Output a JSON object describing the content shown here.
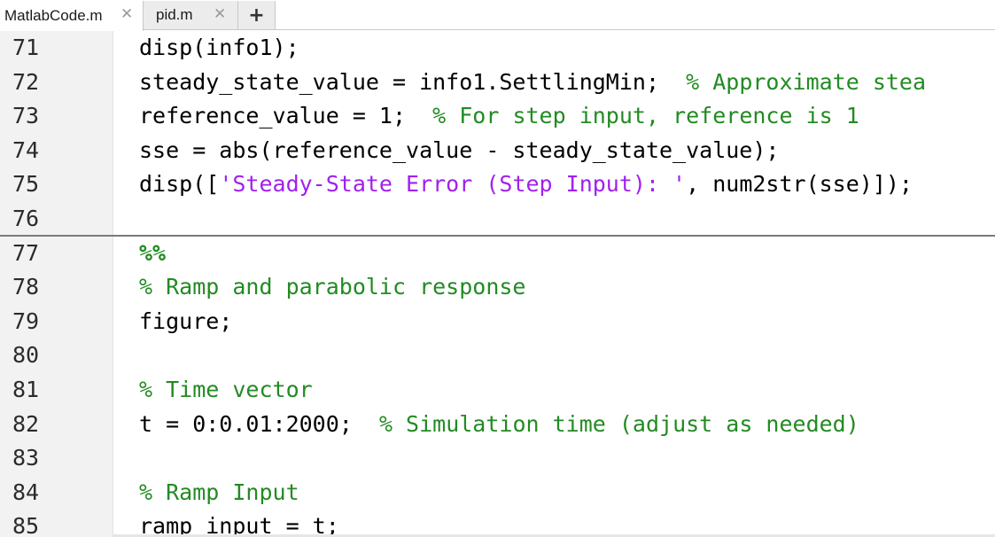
{
  "tabs": [
    {
      "label": "MatlabCode.m",
      "active": true,
      "close_icon": "close-icon"
    },
    {
      "label": "pid.m",
      "active": false,
      "close_icon": "close-icon"
    }
  ],
  "add_tab": {
    "label": "+"
  },
  "colors": {
    "comment": "#228b22",
    "string": "#a020f0",
    "plain": "#000000",
    "gutter": "#f2f2f2"
  },
  "editor": {
    "lines": [
      {
        "num": "71",
        "tokens": [
          {
            "t": "plain",
            "v": "disp(info1);"
          }
        ]
      },
      {
        "num": "72",
        "tokens": [
          {
            "t": "plain",
            "v": "steady_state_value = info1.SettlingMin;  "
          },
          {
            "t": "comment",
            "v": "% Approximate stea"
          }
        ]
      },
      {
        "num": "73",
        "tokens": [
          {
            "t": "plain",
            "v": "reference_value = 1;  "
          },
          {
            "t": "comment",
            "v": "% For step input, reference is 1"
          }
        ]
      },
      {
        "num": "74",
        "tokens": [
          {
            "t": "plain",
            "v": "sse = abs(reference_value - steady_state_value);"
          }
        ]
      },
      {
        "num": "75",
        "tokens": [
          {
            "t": "plain",
            "v": "disp(["
          },
          {
            "t": "string",
            "v": "'Steady-State Error (Step Input): '"
          },
          {
            "t": "plain",
            "v": ", num2str(sse)]);"
          }
        ]
      },
      {
        "num": "76",
        "tokens": []
      },
      {
        "num": "77",
        "tokens": [
          {
            "t": "section",
            "v": "%%"
          }
        ]
      },
      {
        "num": "78",
        "tokens": [
          {
            "t": "comment",
            "v": "% Ramp and parabolic response"
          }
        ]
      },
      {
        "num": "79",
        "tokens": [
          {
            "t": "plain",
            "v": "figure;"
          }
        ]
      },
      {
        "num": "80",
        "tokens": []
      },
      {
        "num": "81",
        "tokens": [
          {
            "t": "comment",
            "v": "% Time vector"
          }
        ]
      },
      {
        "num": "82",
        "tokens": [
          {
            "t": "plain",
            "v": "t = 0:0.01:2000;  "
          },
          {
            "t": "comment",
            "v": "% Simulation time (adjust as needed)"
          }
        ]
      },
      {
        "num": "83",
        "tokens": []
      },
      {
        "num": "84",
        "tokens": [
          {
            "t": "comment",
            "v": "% Ramp Input"
          }
        ]
      },
      {
        "num": "85",
        "tokens": [
          {
            "t": "plain",
            "v": "ramp_input = t;"
          }
        ]
      }
    ]
  }
}
